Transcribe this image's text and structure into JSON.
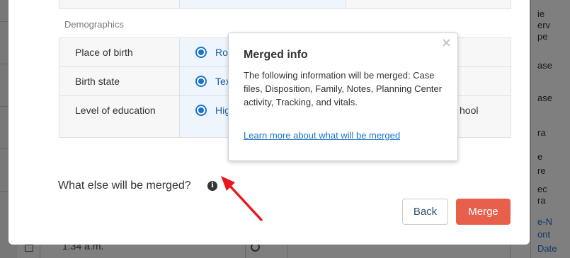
{
  "background": {
    "right_fragments": [
      "ie",
      "erv",
      "pe",
      "ase",
      "ase",
      "ra",
      "e",
      "re",
      "ec",
      "ra",
      "e-N",
      "ont",
      "Date"
    ],
    "bottom_time": "1:34 a.m."
  },
  "modal": {
    "section_title": "Demographics",
    "rows": [
      {
        "label": "Place of birth",
        "selected_value": "Rot",
        "other_value": ""
      },
      {
        "label": "Birth state",
        "selected_value": "Tex",
        "other_value": ""
      },
      {
        "label": "Level of education",
        "selected_value": "Hig",
        "other_value": "hool"
      }
    ],
    "merge_question": "What else will be merged?",
    "info_icon_glyph": "i",
    "buttons": {
      "back": "Back",
      "merge": "Merge"
    }
  },
  "popover": {
    "title": "Merged info",
    "close_glyph": "×",
    "body": "The following information will be merged: Case files, Disposition, Family, Notes, Planning Center activity, Tracking, and vitals.",
    "link": "Learn more about what will be merged"
  },
  "colors": {
    "accent": "#1a73c8",
    "merge_button": "#e8604c",
    "annotation_arrow": "#e8181f"
  }
}
